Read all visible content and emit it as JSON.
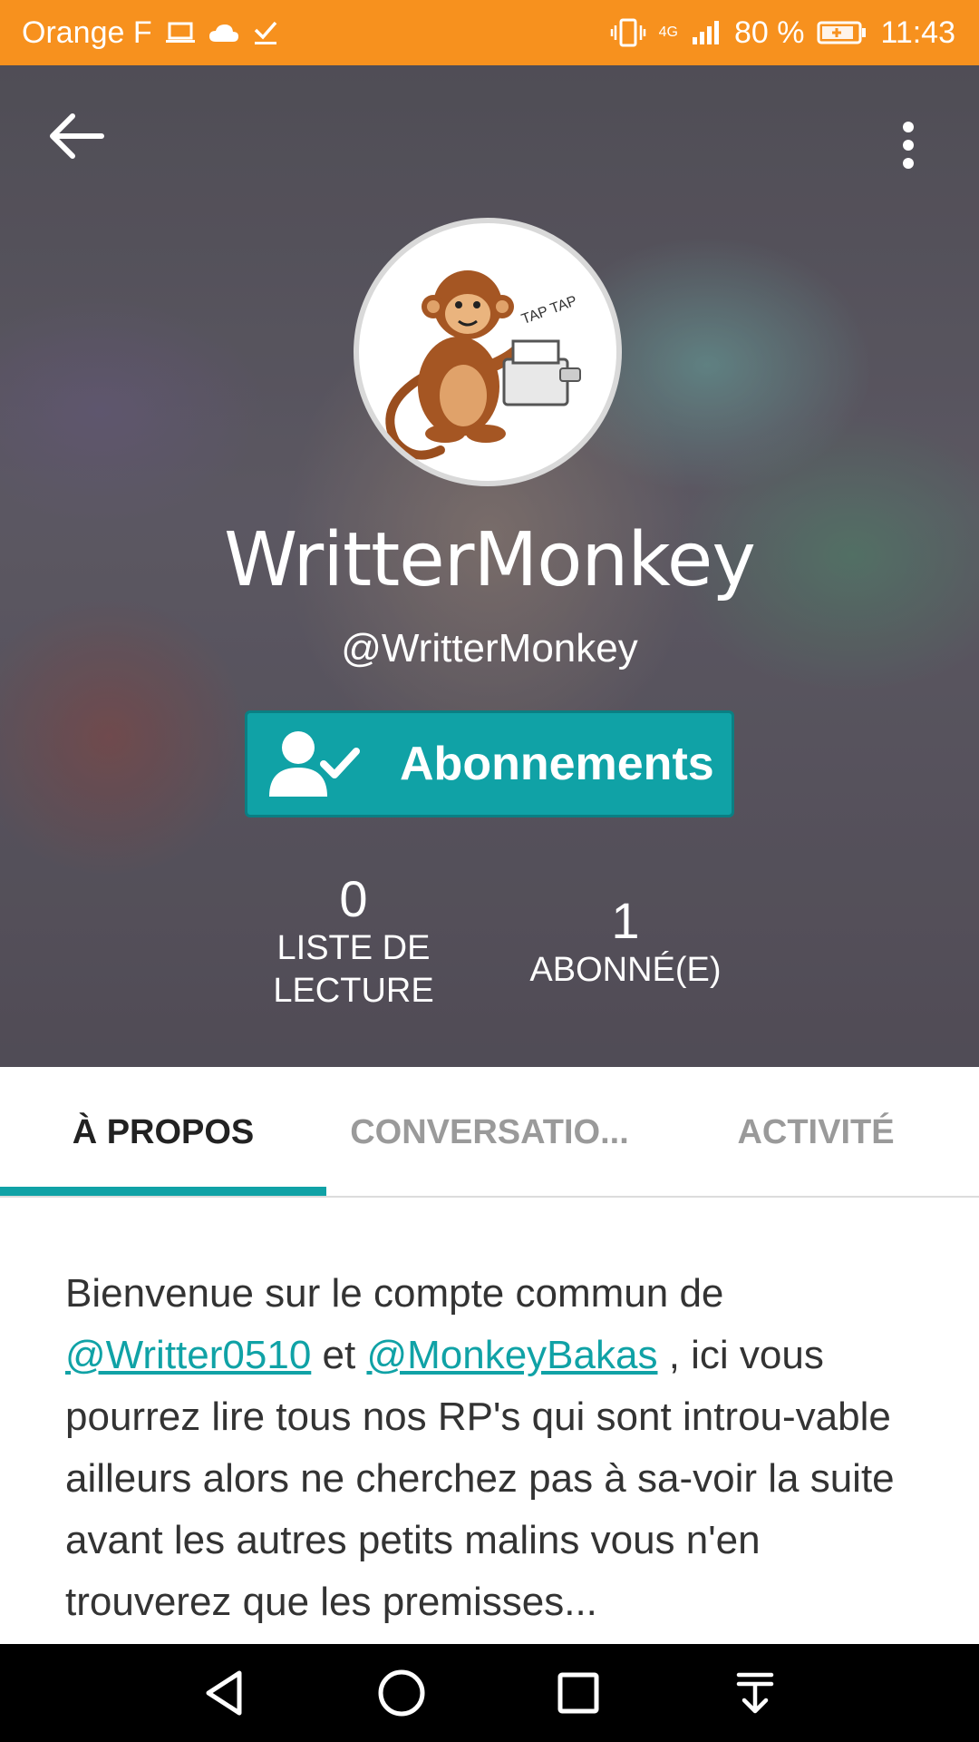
{
  "status_bar": {
    "carrier": "Orange F",
    "network": "4G",
    "battery": "80 %",
    "time": "11:43",
    "color": "#f7911e"
  },
  "profile": {
    "display_name": "WritterMonkey",
    "handle": "@WritterMonkey",
    "avatar_caption": "TAP TAP",
    "follow_button_label": "Abonnements",
    "stats": [
      {
        "value": "0",
        "label_line1": "LISTE DE",
        "label_line2": "LECTURE"
      },
      {
        "value": "1",
        "label_line1": "ABONNÉ(E)"
      }
    ]
  },
  "tabs": [
    {
      "label": "À PROPOS",
      "active": true
    },
    {
      "label": "CONVERSATIO...",
      "active": false
    },
    {
      "label": "ACTIVITÉ",
      "active": false
    }
  ],
  "bio": {
    "part1": "Bienvenue sur le compte commun de",
    "mention1": "@Writter0510",
    "part2": " et ",
    "mention2": "@MonkeyBakas",
    "part3": " , ici vous pourrez lire tous nos RP's qui sont introu-vable ailleurs alors ne cherchez pas à sa-voir la suite avant les autres petits malins vous n'en trouverez que les premisses..."
  },
  "accent_color": "#10a2a6",
  "icons": {
    "back": "arrow-left-icon",
    "more": "more-vertical-icon",
    "follow": "user-check-icon",
    "nav": [
      "back-triangle-icon",
      "home-circle-icon",
      "recents-square-icon",
      "notifications-down-icon"
    ]
  }
}
